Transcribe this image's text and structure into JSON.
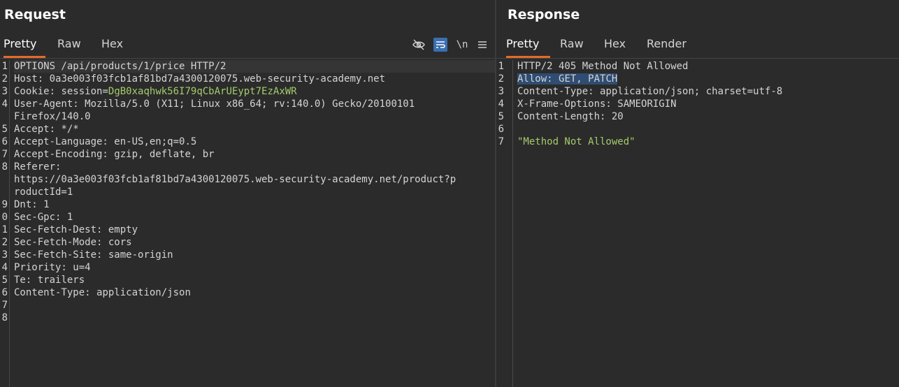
{
  "request": {
    "title": "Request",
    "tabs": [
      "Pretty",
      "Raw",
      "Hex"
    ],
    "active_tab": "Pretty",
    "toolbar": {
      "hide_icon": "eye-slash-icon",
      "wrap_icon": "word-wrap-icon",
      "newline_label": "\\n",
      "menu_icon": "hamburger-menu-icon"
    },
    "lines": [
      {
        "n": "1",
        "text": "OPTIONS /api/products/1/price HTTP/2"
      },
      {
        "n": "2",
        "name": "Host",
        "value": "0a3e003f03fcb1af81bd7a4300120075.web-security-academy.net"
      },
      {
        "n": "3",
        "name": "Cookie",
        "value_prefix": "session=",
        "value": "DgB0xaqhwk56I79qCbArUEypt7EzAxWR"
      },
      {
        "n": "4",
        "name": "User-Agent",
        "value": "Mozilla/5.0 (X11; Linux x86_64; rv:140.0) Gecko/20100101"
      },
      {
        "n": "",
        "text": "Firefox/140.0"
      },
      {
        "n": "5",
        "name": "Accept",
        "value": "*/*"
      },
      {
        "n": "6",
        "name": "Accept-Language",
        "value": "en-US,en;q=0.5"
      },
      {
        "n": "7",
        "name": "Accept-Encoding",
        "value": "gzip, deflate, br"
      },
      {
        "n": "8",
        "name": "Referer",
        "value": ""
      },
      {
        "n": "",
        "text": "https://0a3e003f03fcb1af81bd7a4300120075.web-security-academy.net/product?p"
      },
      {
        "n": "",
        "text": "roductId=1"
      },
      {
        "n": "9",
        "name": "Dnt",
        "value": "1"
      },
      {
        "n": "0",
        "name": "Sec-Gpc",
        "value": "1"
      },
      {
        "n": "1",
        "name": "Sec-Fetch-Dest",
        "value": "empty"
      },
      {
        "n": "2",
        "name": "Sec-Fetch-Mode",
        "value": "cors"
      },
      {
        "n": "3",
        "name": "Sec-Fetch-Site",
        "value": "same-origin"
      },
      {
        "n": "4",
        "name": "Priority",
        "value": "u=4"
      },
      {
        "n": "5",
        "name": "Te",
        "value": "trailers"
      },
      {
        "n": "6",
        "name": "Content-Type",
        "value": "application/json"
      },
      {
        "n": "7",
        "text": ""
      },
      {
        "n": "8",
        "text": ""
      }
    ]
  },
  "response": {
    "title": "Response",
    "tabs": [
      "Pretty",
      "Raw",
      "Hex",
      "Render"
    ],
    "active_tab": "Pretty",
    "lines": [
      {
        "n": "1",
        "text": "HTTP/2 405 Method Not Allowed"
      },
      {
        "n": "2",
        "name": "Allow",
        "value": "GET, PATCH",
        "selected": true
      },
      {
        "n": "3",
        "name": "Content-Type",
        "value": "application/json; charset=utf-8"
      },
      {
        "n": "4",
        "name": "X-Frame-Options",
        "value": "SAMEORIGIN"
      },
      {
        "n": "5",
        "name": "Content-Length",
        "value": "20"
      },
      {
        "n": "6",
        "text": ""
      },
      {
        "n": "7",
        "body": "\"Method Not Allowed\""
      }
    ]
  },
  "colors": {
    "background": "#2b2b2b",
    "accent_tab_underline": "#e36b2c",
    "string_green": "#a4cb6b",
    "selection_blue": "#2f4d72",
    "toolbar_active": "#3a6fb0"
  }
}
